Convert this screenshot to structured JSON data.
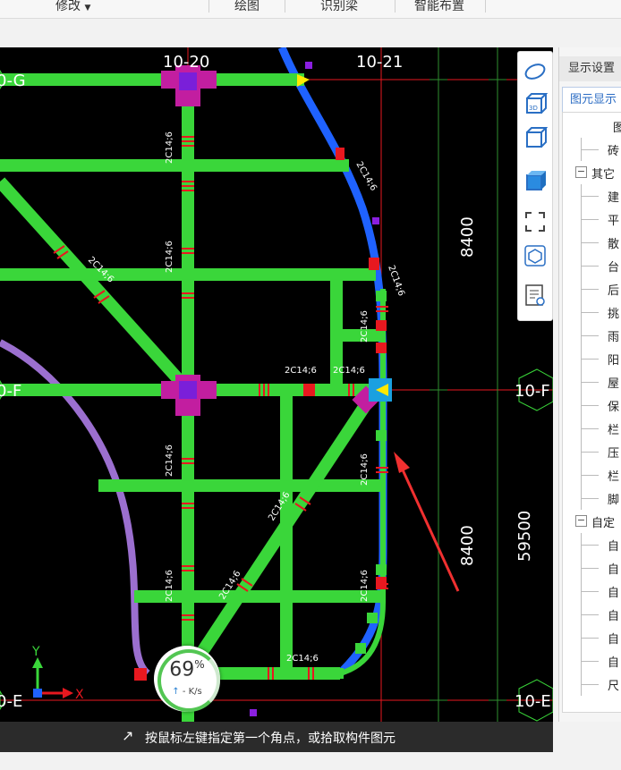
{
  "toolbar": {
    "items": [
      "修改",
      "绘图",
      "识别梁",
      "智能布置"
    ],
    "dropdown_glyph": "▼"
  },
  "canvas": {
    "axis_top": [
      "10-20",
      "10-21"
    ],
    "axis_left": [
      "0-G",
      "0-F",
      "0-E"
    ],
    "axis_right": [
      "10-F",
      "10-E"
    ],
    "dims": [
      "8400",
      "8400",
      "59500"
    ],
    "beam_labels": [
      "2C14;6",
      "2C14;6",
      "2C14;6",
      "2C14;6",
      "2C14;6",
      "2C14;6",
      "2C14;6",
      "2C14;6",
      "2C14;6",
      "2C14;6",
      "2C14;6",
      "2C14;6",
      "2C14;6",
      "2C14;6",
      "2C14;6"
    ],
    "ucs": {
      "x": "X",
      "y": "Y"
    },
    "colors": {
      "beam": "#3ad63a",
      "column": "#c21ea0",
      "curve": "#1f62ff",
      "arc": "#9b6fcf",
      "red": "#e8181f"
    }
  },
  "gauge": {
    "value": "69",
    "unit": "%",
    "speed": "- K/s"
  },
  "status": {
    "message": "按鼠标左键指定第一个角点，或拾取构件图元",
    "cursor_icon": "select-cursor-icon"
  },
  "side_panel": {
    "title": "显示设置",
    "tab": "图元显示",
    "rows": [
      {
        "label": "图",
        "type": "header"
      },
      {
        "label": "砖",
        "type": "leaf"
      },
      {
        "label": "其它",
        "type": "group"
      },
      {
        "label": "建",
        "type": "leaf"
      },
      {
        "label": "平",
        "type": "leaf"
      },
      {
        "label": "散",
        "type": "leaf"
      },
      {
        "label": "台",
        "type": "leaf"
      },
      {
        "label": "后",
        "type": "leaf"
      },
      {
        "label": "挑",
        "type": "leaf"
      },
      {
        "label": "雨",
        "type": "leaf"
      },
      {
        "label": "阳",
        "type": "leaf"
      },
      {
        "label": "屋",
        "type": "leaf"
      },
      {
        "label": "保",
        "type": "leaf"
      },
      {
        "label": "栏",
        "type": "leaf"
      },
      {
        "label": "压",
        "type": "leaf"
      },
      {
        "label": "栏",
        "type": "leaf"
      },
      {
        "label": "脚",
        "type": "leaf"
      },
      {
        "label": "自定",
        "type": "group"
      },
      {
        "label": "自",
        "type": "leaf"
      },
      {
        "label": "自",
        "type": "leaf"
      },
      {
        "label": "自",
        "type": "leaf"
      },
      {
        "label": "自",
        "type": "leaf"
      },
      {
        "label": "自",
        "type": "leaf"
      },
      {
        "label": "自",
        "type": "leaf"
      },
      {
        "label": "尺",
        "type": "leaf"
      }
    ]
  },
  "view_tools": [
    "orbit-icon",
    "3d-view-icon",
    "cube-icon",
    "cube-filled-icon",
    "zoom-extents-icon",
    "view-cube-icon",
    "properties-icon"
  ]
}
